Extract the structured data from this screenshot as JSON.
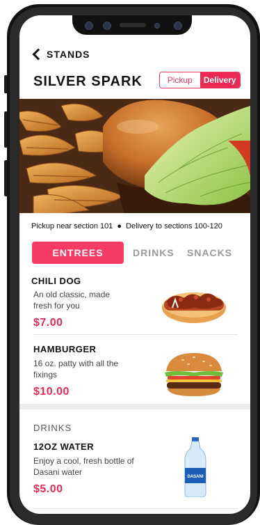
{
  "header": {
    "back_label": "STANDS",
    "stand_name": "SILVER SPARK",
    "mode_toggle": {
      "pickup": "Pickup",
      "delivery": "Delivery",
      "selected": "Delivery"
    }
  },
  "info": {
    "pickup": "Pickup near section 101",
    "delivery": "Delivery to sections 100-120"
  },
  "tabs": [
    {
      "label": "ENTREES",
      "active": true
    },
    {
      "label": "DRINKS",
      "active": false
    },
    {
      "label": "SNACKS",
      "active": false
    }
  ],
  "entrees": [
    {
      "name": "CHILI DOG",
      "description": "An old classic, made fresh for you",
      "price": "$7.00"
    },
    {
      "name": "HAMBURGER",
      "description": "16 oz. patty with all the fixings",
      "price": "$10.00"
    }
  ],
  "drinks_section": {
    "label": "DRINKS",
    "items": [
      {
        "name": "12OZ WATER",
        "description": "Enjoy a cool, fresh bottle of Dasani water",
        "price": "$5.00",
        "bottle_label": "DASANI"
      }
    ]
  },
  "colors": {
    "accent": "#ea2a54",
    "tab_inactive": "#9a9a9a"
  }
}
